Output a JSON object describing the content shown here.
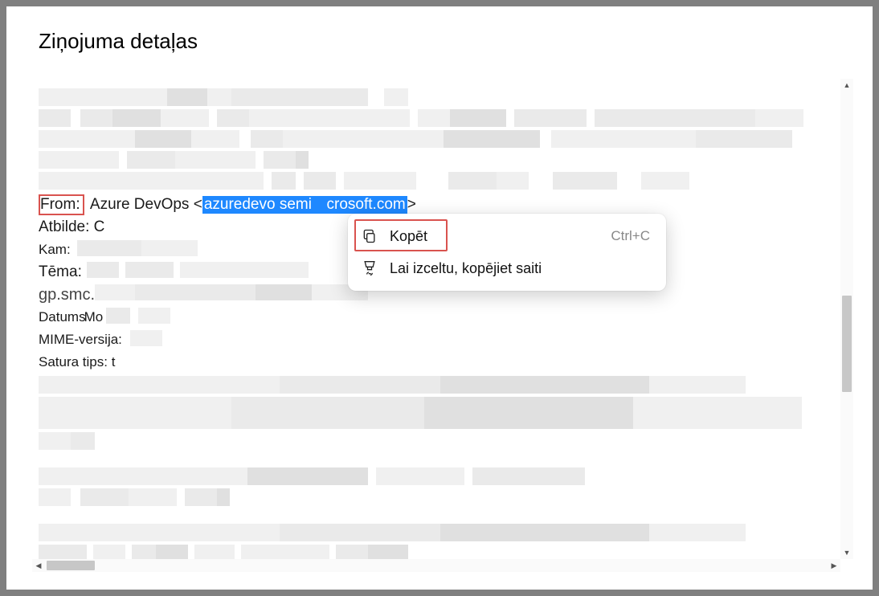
{
  "title": "Ziņojuma detaļas",
  "from": {
    "label": "From:",
    "sender_name": "Azure DevOps",
    "selected_part1": "azuredevo semi",
    "selected_part2": "crosoft.com"
  },
  "reply": {
    "label": "Atbilde:",
    "value": "C"
  },
  "to": {
    "label": "Kam:"
  },
  "subject": {
    "label": "Tēma:"
  },
  "gp_line": "gp.smc.",
  "date": {
    "label": "Datums",
    "frag": "Mo"
  },
  "mime": {
    "label": "MIME-versija:"
  },
  "contenttype": {
    "label": "Satura tips:",
    "value": "t"
  },
  "ctx": {
    "copy": "Kopēt",
    "copy_shortcut": "Ctrl+C",
    "copy_link": "Lai izceltu, kopējiet saiti"
  }
}
